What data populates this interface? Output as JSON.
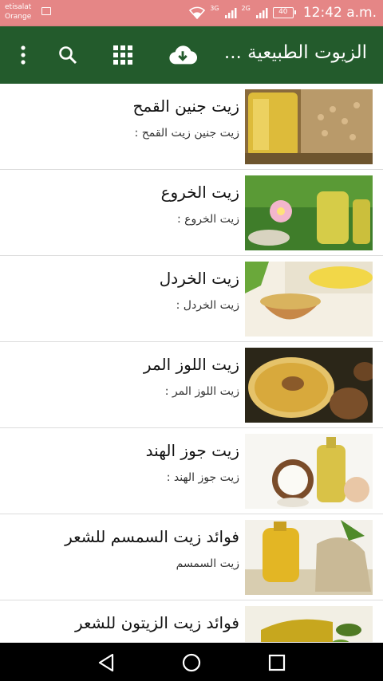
{
  "status_bar": {
    "carrier_line1": "etisalat",
    "carrier_line2": "Orange",
    "net1": "3G",
    "net2": "2G",
    "battery": "40",
    "time": "12:42 a.m."
  },
  "app_bar": {
    "title": "الزيوت الطبيعية ...",
    "icons": [
      "cloud-download-icon",
      "grid-icon",
      "search-icon",
      "more-vert-icon"
    ]
  },
  "items": [
    {
      "title": "زيت جنين القمح",
      "subtitle": "زيت جنين زيت القمح :",
      "image": "wheat-germ-oil-photo"
    },
    {
      "title": "زيت الخروع",
      "subtitle": "زيت الخروع :",
      "image": "castor-oil-photo"
    },
    {
      "title": "زيت الخردل",
      "subtitle": "زيت الخردل :",
      "image": "mustard-oil-photo"
    },
    {
      "title": "زيت اللوز المر",
      "subtitle": "زيت اللوز المر :",
      "image": "bitter-almond-oil-photo"
    },
    {
      "title": "زيت جوز الهند",
      "subtitle": "زيت جوز الهند :",
      "image": "coconut-oil-photo"
    },
    {
      "title": "فوائد زيت السمسم للشعر",
      "subtitle": "زيت السمسم",
      "image": "sesame-oil-photo"
    },
    {
      "title": "فوائد  زيت الزيتون للشعر",
      "subtitle": "",
      "image": "olive-oil-photo"
    }
  ],
  "nav_bar": {
    "icons": [
      "back-icon",
      "home-icon",
      "recents-icon"
    ]
  },
  "colors": {
    "app_bar": "#235b2c",
    "status_bar": "#e58686",
    "divider": "#dcdcdc"
  }
}
